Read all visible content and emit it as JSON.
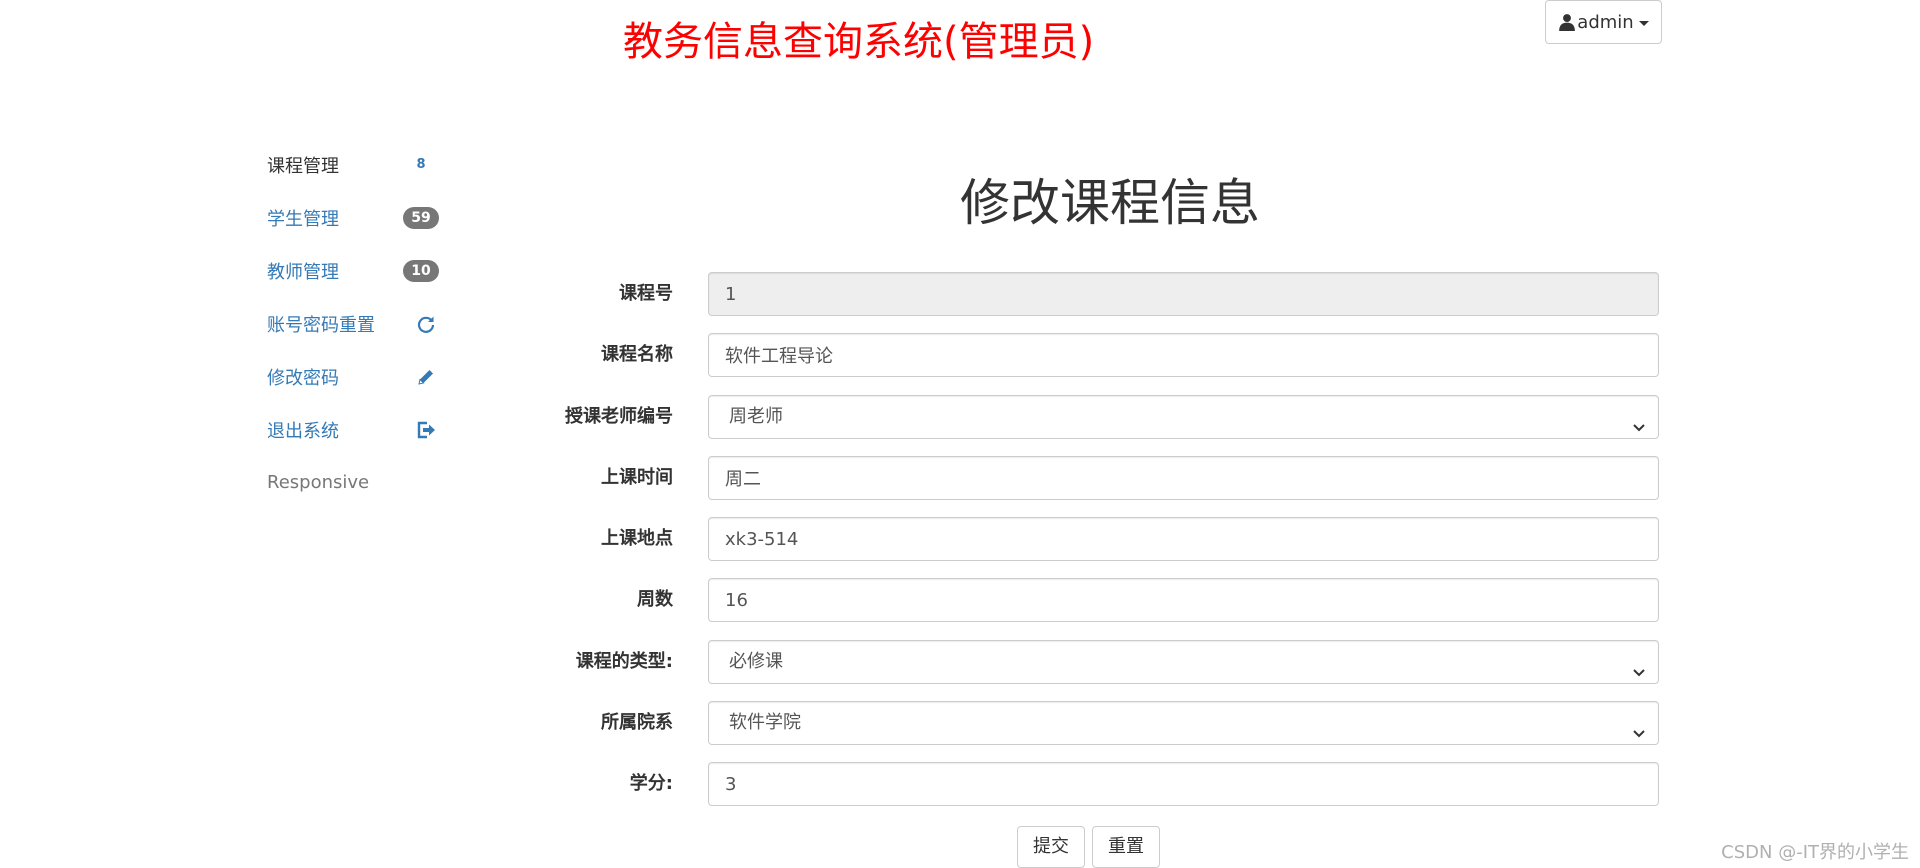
{
  "header": {
    "app_title": "教务信息查询系统(管理员)",
    "user_menu_label": "admin"
  },
  "sidebar": {
    "items": [
      {
        "label": "课程管理",
        "badge": "8",
        "active": true
      },
      {
        "label": "学生管理",
        "badge": "59"
      },
      {
        "label": "教师管理",
        "badge": "10"
      },
      {
        "label": "账号密码重置",
        "icon": "refresh-icon"
      },
      {
        "label": "修改密码",
        "icon": "pencil-icon"
      },
      {
        "label": "退出系统",
        "icon": "logout-icon"
      },
      {
        "label": "Responsive"
      }
    ]
  },
  "main": {
    "heading": "修改课程信息",
    "fields": {
      "course_id": {
        "label": "课程号",
        "value": "1"
      },
      "course_name": {
        "label": "课程名称",
        "value": "软件工程导论"
      },
      "teacher": {
        "label": "授课老师编号",
        "value": "周老师"
      },
      "class_time": {
        "label": "上课时间",
        "value": "周二"
      },
      "class_location": {
        "label": "上课地点",
        "value": "xk3-514"
      },
      "weeks": {
        "label": "周数",
        "value": "16"
      },
      "course_type": {
        "label": "课程的类型:",
        "value": "必修课"
      },
      "department": {
        "label": "所属院系",
        "value": "软件学院"
      },
      "credits": {
        "label": "学分:",
        "value": "3"
      }
    },
    "submit_label": "提交",
    "reset_label": "重置"
  },
  "watermark": "CSDN @-IT界的小学生",
  "colors": {
    "title": "#ff0000",
    "link": "#337ab7",
    "badge": "#777777",
    "readonly_bg": "#eeeeee"
  }
}
